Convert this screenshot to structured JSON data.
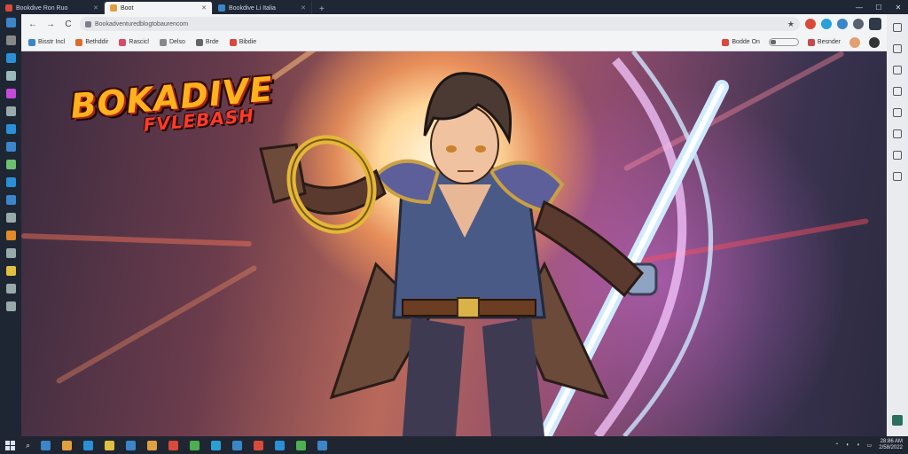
{
  "tabs": [
    {
      "label": "Bookdive Ron Ruo",
      "icon": "app-favicon-icon",
      "color": "#d94a3a",
      "active": false
    },
    {
      "label": "Boot",
      "icon": "page-favicon-icon",
      "color": "#e0a040",
      "active": true
    },
    {
      "label": "Bookdive Li Italia",
      "icon": "page-favicon-icon",
      "color": "#3b86c9",
      "active": false
    }
  ],
  "toolbar": {
    "url": "Bookadventuredblogtobaurencom",
    "back": "←",
    "forward": "→",
    "reload": "C"
  },
  "bookmarks": [
    {
      "label": "Bisstr Incl",
      "color": "#3b86c9"
    },
    {
      "label": "Bethddir",
      "color": "#e06a2a"
    },
    {
      "label": "Rascicl",
      "color": "#d94a6a"
    },
    {
      "label": "Delso",
      "color": "#888888"
    },
    {
      "label": "Brde",
      "color": "#666666"
    },
    {
      "label": "Bibdie",
      "color": "#d94a3a"
    }
  ],
  "bookmarks_right": {
    "item1": "Bodde On",
    "item2": "Besnder"
  },
  "hero": {
    "headline_line1": "BOKADIVE",
    "headline_line2": "FVLEBASH"
  },
  "colors": {
    "chrome_dark": "#1f2735",
    "toolbar": "#f3f4f6",
    "accent_red": "#d94a3a",
    "headline_gold": "#ffb21c"
  },
  "leftbar_icons": [
    "#3b86c9",
    "#888",
    "#2a8fd6",
    "#9bb",
    "#c64ad9",
    "#9aa",
    "#2a8fd6",
    "#3b86c9",
    "#6cc070",
    "#2a8fd6",
    "#3b86c9",
    "#9aa",
    "#e08a2a",
    "#9aa",
    "#e0c040",
    "#9aa",
    "#9aa"
  ],
  "taskbar_icons": [
    "#3b86c9",
    "#e0a040",
    "#2a8fd6",
    "#e0c040",
    "#3b86c9",
    "#e0a040",
    "#d94a3a",
    "#4caf50",
    "#2a9fd6",
    "#3b86c9",
    "#d94a3a",
    "#2a8fd6",
    "#4caf50",
    "#3b86c9"
  ],
  "tray": {
    "time": "28:86 AM",
    "date": "2/58/2022"
  }
}
